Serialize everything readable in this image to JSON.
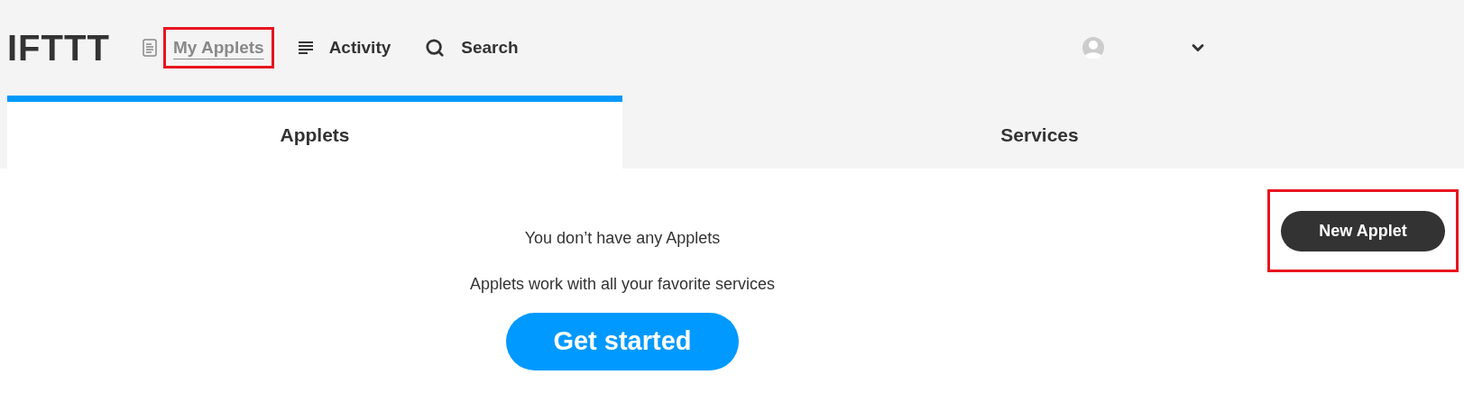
{
  "header": {
    "logo": "IFTTT",
    "nav": [
      {
        "kind": "applets",
        "label": "My Applets",
        "selected": true,
        "highlighted": true
      },
      {
        "kind": "activity",
        "label": "Activity",
        "selected": false,
        "highlighted": false
      },
      {
        "kind": "search",
        "label": "Search",
        "selected": false,
        "highlighted": false
      }
    ]
  },
  "tabs": [
    {
      "label": "Applets",
      "selected": true
    },
    {
      "label": "Services",
      "selected": false
    }
  ],
  "empty_state": {
    "title": "You don’t have any Applets",
    "subtitle": "Applets work with all your favorite services",
    "button": "Get started"
  },
  "new_applet_button": {
    "label": "New Applet",
    "highlighted": true
  }
}
